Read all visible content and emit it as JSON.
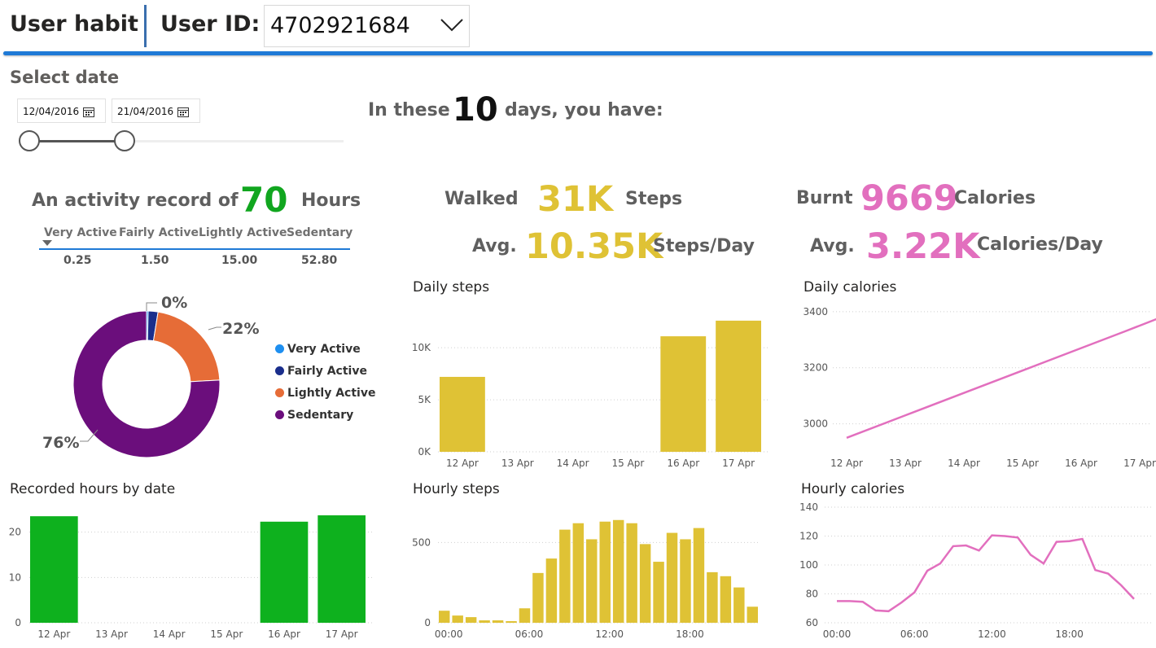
{
  "header": {
    "title": "User habit",
    "user_label": "User ID:",
    "user_id": "4702921684"
  },
  "date_filter": {
    "label": "Select date",
    "start": "12/04/2016",
    "end": "21/04/2016"
  },
  "summary": {
    "prefix": "In these",
    "days": "10",
    "suffix": "days, you have:"
  },
  "activity": {
    "prefix": "An activity record of",
    "hours": "70",
    "unit": "Hours",
    "columns": [
      "Very Active",
      "Fairly Active",
      "Lightly Active",
      "Sedentary"
    ],
    "values": [
      "0.25",
      "1.50",
      "15.00",
      "52.80"
    ]
  },
  "steps": {
    "walked_label": "Walked",
    "total": "31K",
    "unit": "Steps",
    "avg_label": "Avg.",
    "avg": "10.35K",
    "avg_unit": "Steps/Day"
  },
  "calories": {
    "burnt_label": "Burnt",
    "total": "9669",
    "unit": "Calories",
    "avg_label": "Avg.",
    "avg": "3.22K",
    "avg_unit": "Calories/Day"
  },
  "colors": {
    "green": "#11a61f",
    "gold": "#dfc235",
    "pink": "#e26fbe",
    "very_active": "#1e8ff0",
    "fairly_active": "#1a2e8c",
    "lightly_active": "#e66c37",
    "sedentary": "#6b0e7c",
    "bar_green": "#0eb11e"
  },
  "chart_data": [
    {
      "id": "donut",
      "type": "pie",
      "title": "",
      "categories": [
        "Very Active",
        "Fairly Active",
        "Lightly Active",
        "Sedentary"
      ],
      "values": [
        0.25,
        1.5,
        15.0,
        52.8
      ],
      "data_labels": [
        "0%",
        "22%",
        "76%"
      ],
      "legend": "right"
    },
    {
      "id": "daily_steps",
      "type": "bar",
      "title": "Daily steps",
      "categories": [
        "12 Apr",
        "13 Apr",
        "14 Apr",
        "15 Apr",
        "16 Apr",
        "17 Apr"
      ],
      "values": [
        7200,
        0,
        0,
        0,
        11100,
        12600
      ],
      "ylim": [
        0,
        14000
      ],
      "yticks": [
        0,
        5000,
        10000
      ],
      "ytick_labels": [
        "0K",
        "5K",
        "10K"
      ],
      "grid": true
    },
    {
      "id": "daily_calories",
      "type": "line",
      "title": "Daily calories",
      "categories": [
        "12 Apr",
        "13 Apr",
        "14 Apr",
        "15 Apr",
        "16 Apr",
        "17 Apr"
      ],
      "values": [
        2950,
        3030,
        3110,
        3190,
        3270,
        3330,
        3395
      ],
      "x_positions": [
        0,
        1,
        2,
        3,
        4,
        4.75,
        5.55
      ],
      "ylim": [
        2900,
        3420
      ],
      "yticks": [
        3000,
        3200,
        3400
      ],
      "grid": true
    },
    {
      "id": "recorded_hours",
      "type": "bar",
      "title": "Recorded hours by date",
      "categories": [
        "12 Apr",
        "13 Apr",
        "14 Apr",
        "15 Apr",
        "16 Apr",
        "17 Apr"
      ],
      "values": [
        23.5,
        0,
        0,
        0,
        22.3,
        23.7
      ],
      "ylim": [
        0,
        25.5
      ],
      "yticks": [
        0,
        10,
        20
      ],
      "grid": true
    },
    {
      "id": "hourly_steps",
      "type": "bar",
      "title": "Hourly steps",
      "categories": [
        "00:00",
        "06:00",
        "12:00",
        "18:00"
      ],
      "values": [
        75,
        45,
        35,
        15,
        15,
        10,
        90,
        310,
        400,
        580,
        620,
        520,
        630,
        640,
        620,
        490,
        380,
        560,
        520,
        590,
        315,
        290,
        220,
        100
      ],
      "ylim": [
        0,
        720
      ],
      "yticks": [
        0,
        500
      ],
      "grid": true
    },
    {
      "id": "hourly_calories",
      "type": "line",
      "title": "Hourly calories",
      "categories": [
        "00:00",
        "06:00",
        "12:00",
        "18:00"
      ],
      "values": [
        75,
        75,
        74.5,
        68.5,
        68,
        74,
        81,
        96,
        101,
        113,
        113.5,
        110,
        120.5,
        120,
        119,
        107,
        101,
        116,
        116.5,
        118,
        96.5,
        94,
        86,
        76.5
      ],
      "ylim": [
        60,
        140
      ],
      "yticks": [
        60,
        80,
        100,
        120,
        140
      ],
      "grid": true
    }
  ]
}
